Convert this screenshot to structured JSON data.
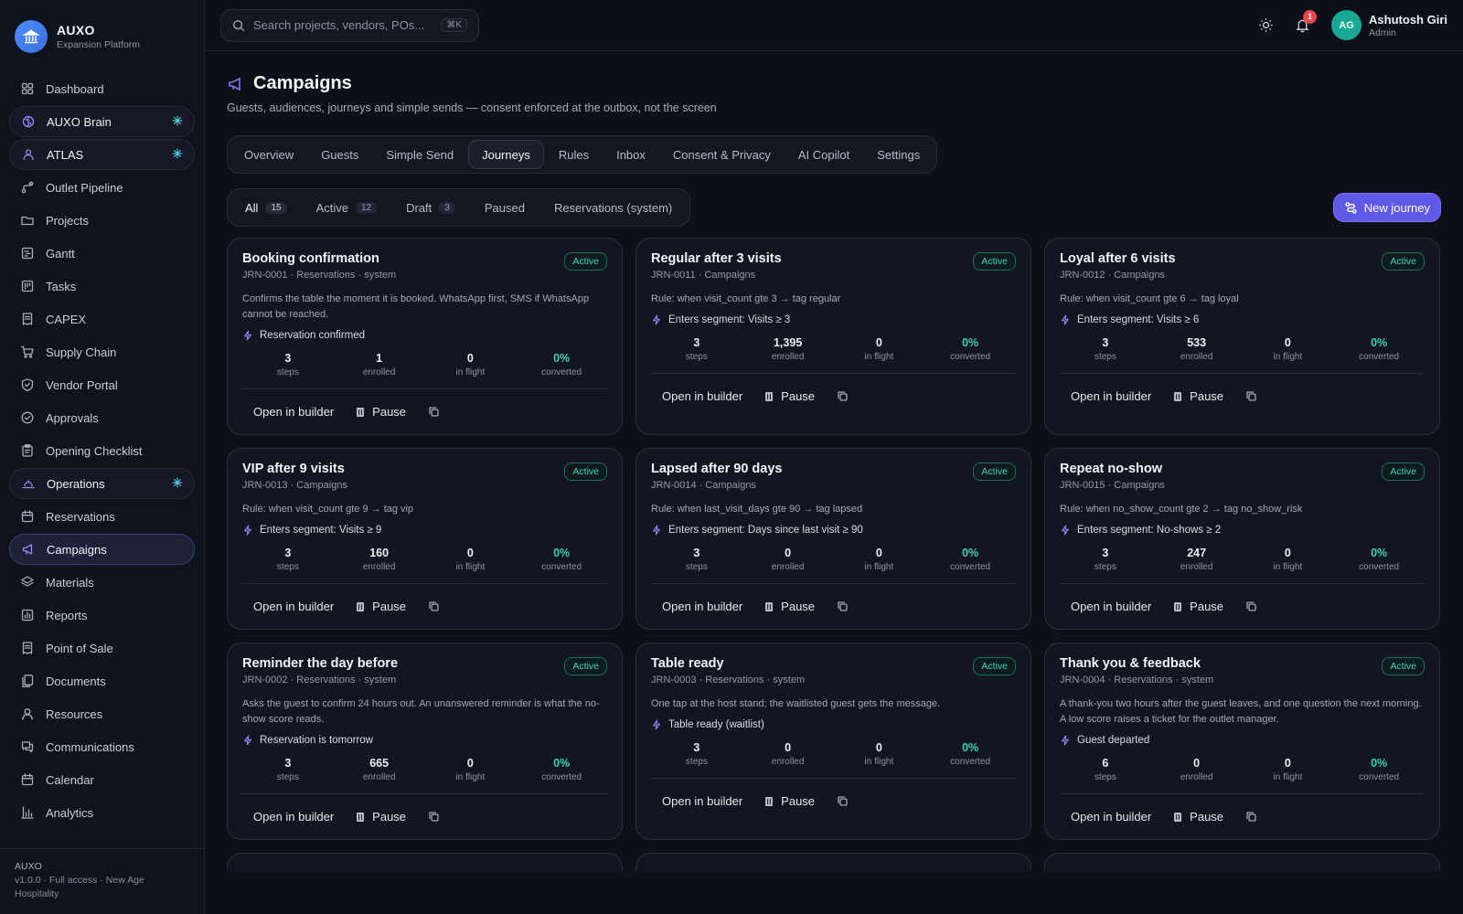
{
  "brand": {
    "name": "AUXO",
    "subtitle": "Expansion Platform"
  },
  "sidebar": {
    "items": [
      {
        "label": "Dashboard",
        "icon": "grid-icon"
      },
      {
        "label": "AUXO Brain",
        "icon": "brain-icon"
      },
      {
        "label": "ATLAS",
        "icon": "users-icon"
      },
      {
        "label": "Outlet Pipeline",
        "icon": "route-icon"
      },
      {
        "label": "Projects",
        "icon": "folder-icon"
      },
      {
        "label": "Gantt",
        "icon": "gantt-icon"
      },
      {
        "label": "Tasks",
        "icon": "tasks-icon"
      },
      {
        "label": "CAPEX",
        "icon": "receipt-icon"
      },
      {
        "label": "Supply Chain",
        "icon": "cart-icon"
      },
      {
        "label": "Vendor Portal",
        "icon": "shield-icon"
      },
      {
        "label": "Approvals",
        "icon": "check-circle-icon"
      },
      {
        "label": "Opening Checklist",
        "icon": "clipboard-icon"
      },
      {
        "label": "Operations",
        "icon": "operations-icon"
      },
      {
        "label": "Reservations",
        "icon": "calendar-icon"
      },
      {
        "label": "Campaigns",
        "icon": "megaphone-icon"
      },
      {
        "label": "Materials",
        "icon": "layers-icon"
      },
      {
        "label": "Reports",
        "icon": "bar-chart-icon"
      },
      {
        "label": "Point of Sale",
        "icon": "receipt-icon"
      },
      {
        "label": "Documents",
        "icon": "documents-icon"
      },
      {
        "label": "Resources",
        "icon": "user-icon"
      },
      {
        "label": "Communications",
        "icon": "chat-icon"
      },
      {
        "label": "Calendar",
        "icon": "calendar-icon"
      },
      {
        "label": "Analytics",
        "icon": "analytics-icon"
      }
    ],
    "footer": {
      "title": "AUXO",
      "line1": "v1.0.0 · Full access · New Age",
      "line2": "Hospitality"
    }
  },
  "search": {
    "placeholder": "Search projects, vendors, POs...",
    "shortcut": "⌘K"
  },
  "notifications": {
    "count": "1"
  },
  "user": {
    "initials": "AG",
    "name": "Ashutosh Giri",
    "role": "Admin"
  },
  "page": {
    "title": "Campaigns",
    "subtitle": "Guests, audiences, journeys and simple sends — consent enforced at the outbox, not the screen"
  },
  "tabs": [
    "Overview",
    "Guests",
    "Simple Send",
    "Journeys",
    "Rules",
    "Inbox",
    "Consent & Privacy",
    "AI Copilot",
    "Settings"
  ],
  "filters": [
    {
      "label": "All",
      "count": "15"
    },
    {
      "label": "Active",
      "count": "12"
    },
    {
      "label": "Draft",
      "count": "3"
    },
    {
      "label": "Paused",
      "count": ""
    },
    {
      "label": "Reservations (system)",
      "count": ""
    }
  ],
  "new_journey_label": "New journey",
  "card_labels": {
    "steps": "steps",
    "enrolled": "enrolled",
    "in_flight": "in flight",
    "converted": "converted",
    "open": "Open in builder",
    "pause": "Pause"
  },
  "journeys": [
    {
      "title": "Booking confirmation",
      "meta": "JRN-0001 · Reservations · system",
      "status": "Active",
      "desc": "Confirms the table the moment it is booked. WhatsApp first, SMS if WhatsApp cannot be reached.",
      "trigger": "Reservation confirmed",
      "steps": "3",
      "enrolled": "1",
      "in_flight": "0",
      "converted": "0%"
    },
    {
      "title": "Regular after 3 visits",
      "meta": "JRN-0011 · Campaigns",
      "status": "Active",
      "desc": "Rule: when visit_count gte 3 → tag regular",
      "trigger": "Enters segment: Visits ≥ 3",
      "steps": "3",
      "enrolled": "1,395",
      "in_flight": "0",
      "converted": "0%"
    },
    {
      "title": "Loyal after 6 visits",
      "meta": "JRN-0012 · Campaigns",
      "status": "Active",
      "desc": "Rule: when visit_count gte 6 → tag loyal",
      "trigger": "Enters segment: Visits ≥ 6",
      "steps": "3",
      "enrolled": "533",
      "in_flight": "0",
      "converted": "0%"
    },
    {
      "title": "VIP after 9 visits",
      "meta": "JRN-0013 · Campaigns",
      "status": "Active",
      "desc": "Rule: when visit_count gte 9 → tag vip",
      "trigger": "Enters segment: Visits ≥ 9",
      "steps": "3",
      "enrolled": "160",
      "in_flight": "0",
      "converted": "0%"
    },
    {
      "title": "Lapsed after 90 days",
      "meta": "JRN-0014 · Campaigns",
      "status": "Active",
      "desc": "Rule: when last_visit_days gte 90 → tag lapsed",
      "trigger": "Enters segment: Days since last visit ≥ 90",
      "steps": "3",
      "enrolled": "0",
      "in_flight": "0",
      "converted": "0%"
    },
    {
      "title": "Repeat no-show",
      "meta": "JRN-0015 · Campaigns",
      "status": "Active",
      "desc": "Rule: when no_show_count gte 2 → tag no_show_risk",
      "trigger": "Enters segment: No-shows ≥ 2",
      "steps": "3",
      "enrolled": "247",
      "in_flight": "0",
      "converted": "0%"
    },
    {
      "title": "Reminder the day before",
      "meta": "JRN-0002 · Reservations · system",
      "status": "Active",
      "desc": "Asks the guest to confirm 24 hours out. An unanswered reminder is what the no-show score reads.",
      "trigger": "Reservation is tomorrow",
      "steps": "3",
      "enrolled": "665",
      "in_flight": "0",
      "converted": "0%"
    },
    {
      "title": "Table ready",
      "meta": "JRN-0003 · Reservations · system",
      "status": "Active",
      "desc": "One tap at the host stand; the waitlisted guest gets the message.",
      "trigger": "Table ready (waitlist)",
      "steps": "3",
      "enrolled": "0",
      "in_flight": "0",
      "converted": "0%"
    },
    {
      "title": "Thank you & feedback",
      "meta": "JRN-0004 · Reservations · system",
      "status": "Active",
      "desc": "A thank-you two hours after the guest leaves, and one question the next morning. A low score raises a ticket for the outlet manager.",
      "trigger": "Guest departed",
      "steps": "6",
      "enrolled": "0",
      "in_flight": "0",
      "converted": "0%"
    }
  ],
  "colors": {
    "accent": "#6059e8",
    "active_green": "#45d4b5",
    "background": "#0d1017"
  }
}
